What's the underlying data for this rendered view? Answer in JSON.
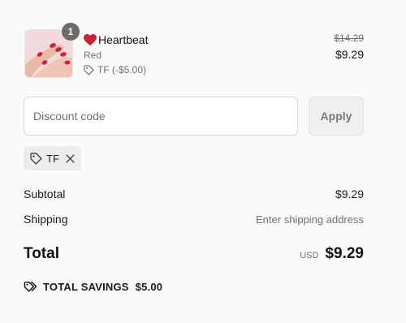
{
  "line_item": {
    "quantity": "1",
    "title": "Heartbeat",
    "variant": "Red",
    "discount": "TF (-$5.00)",
    "original_price": "$14.29",
    "price": "$9.29"
  },
  "discount_form": {
    "placeholder": "Discount code",
    "apply_label": "Apply"
  },
  "applied_code": {
    "label": "TF"
  },
  "summary": {
    "subtotal_label": "Subtotal",
    "subtotal_value": "$9.29",
    "shipping_label": "Shipping",
    "shipping_value": "Enter shipping address",
    "total_label": "Total",
    "currency": "USD",
    "total_value": "$9.29",
    "savings_label": "TOTAL SAVINGS",
    "savings_value": "$5.00"
  },
  "icons": {
    "heart": "heart-icon",
    "tag": "tag-icon",
    "close": "close-icon",
    "savings_tag": "tags-icon"
  },
  "colors": {
    "heart": "#d3222d",
    "apply_bg": "#efefef",
    "chip_bg": "#ececec"
  }
}
